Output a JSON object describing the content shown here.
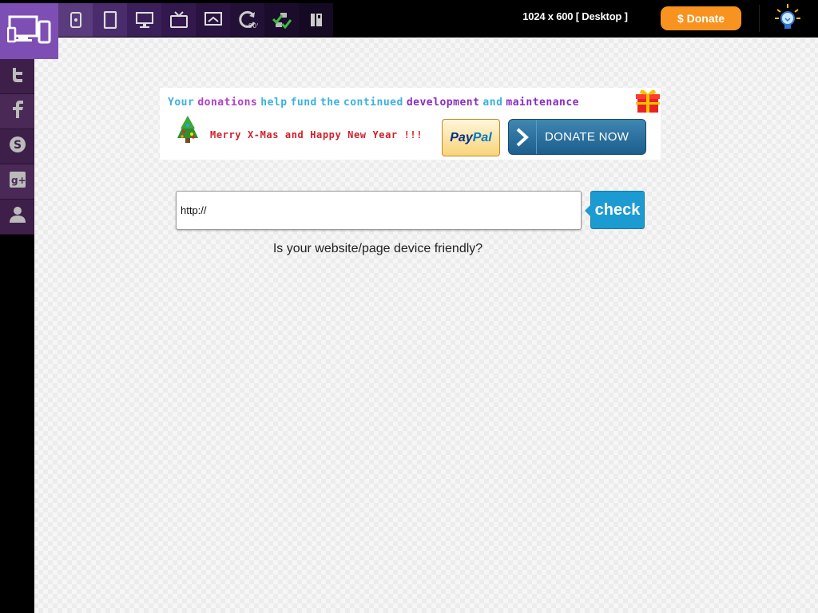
{
  "header": {
    "logo_icon": "responsive-devices-icon",
    "tools": [
      {
        "name": "tool-phone",
        "icon": "phone-portrait-icon"
      },
      {
        "name": "tool-tablet",
        "icon": "tablet-icon"
      },
      {
        "name": "tool-desktop",
        "icon": "desktop-monitor-icon"
      },
      {
        "name": "tool-tv",
        "icon": "tv-icon"
      },
      {
        "name": "tool-cast",
        "icon": "screen-cast-icon"
      },
      {
        "name": "tool-rotate",
        "icon": "rotate-90-icon",
        "label": "90°"
      },
      {
        "name": "tool-check",
        "icon": "check-network-icon"
      },
      {
        "name": "tool-book",
        "icon": "book-icon"
      }
    ],
    "resolution_label": "1024 x 600 [ Desktop ]",
    "donate_label": "$ Donate",
    "bulb_icon": "lightbulb-icon"
  },
  "social": [
    {
      "name": "twitter",
      "icon": "twitter-icon"
    },
    {
      "name": "facebook",
      "icon": "facebook-icon"
    },
    {
      "name": "skype",
      "icon": "skype-icon"
    },
    {
      "name": "google-plus",
      "icon": "google-plus-icon"
    },
    {
      "name": "user",
      "icon": "user-icon"
    }
  ],
  "banner": {
    "headline_words": [
      {
        "text": "Your",
        "color": "#3ab0e0"
      },
      {
        "text": "donations",
        "color": "#b33fc7"
      },
      {
        "text": "help",
        "color": "#3ab0e0"
      },
      {
        "text": "fund",
        "color": "#3ab0e0"
      },
      {
        "text": "the",
        "color": "#3ab0e0"
      },
      {
        "text": "continued",
        "color": "#3ab0e0"
      },
      {
        "text": "development",
        "color": "#8a2bbf"
      },
      {
        "text": "and",
        "color": "#3ab0e0"
      },
      {
        "text": "maintenance",
        "color": "#8a2bbf"
      }
    ],
    "greeting": "Merry X-Mas and Happy New Year !!!",
    "paypal_pay": "Pay",
    "paypal_pal": "Pal",
    "donate_now_label": "DONATE NOW"
  },
  "url_check": {
    "input_value": "http://",
    "check_label": "check",
    "tagline": "Is your website/page device friendly?"
  },
  "colors": {
    "brand_purple": "#7d4fb4",
    "social_bg": "#3e1f4a",
    "donate_orange": "#f7931e",
    "check_blue": "#1b9bd1"
  }
}
